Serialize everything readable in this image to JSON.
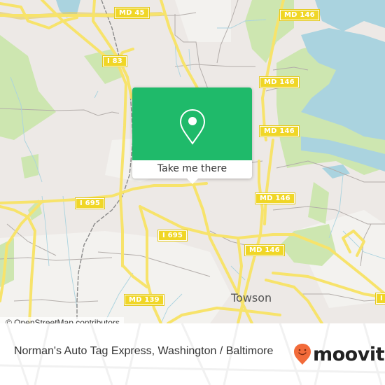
{
  "map": {
    "colors": {
      "land": "#ede9e6",
      "park": "#cde6b0",
      "water": "#aad3df",
      "road_major": "#f7e36b",
      "road_minor": "#b3adaa",
      "rail": "#8a8a8a",
      "shield": "#f0d626"
    },
    "road_labels": [
      {
        "id": "md45",
        "text": "MD 45"
      },
      {
        "id": "i83",
        "text": "I 83"
      },
      {
        "id": "md146-a",
        "text": "MD 146"
      },
      {
        "id": "md146-b",
        "text": "MD 146"
      },
      {
        "id": "md146-c",
        "text": "MD 146"
      },
      {
        "id": "md146-d",
        "text": "MD 146"
      },
      {
        "id": "md146-e",
        "text": "MD 146"
      },
      {
        "id": "i695-a",
        "text": "I 695"
      },
      {
        "id": "i695-b",
        "text": "I 695"
      },
      {
        "id": "md139",
        "text": "MD 139"
      },
      {
        "id": "partial-right",
        "text": "I"
      }
    ],
    "place_labels": [
      {
        "id": "towson",
        "text": "Towson"
      }
    ],
    "attribution": "© OpenStreetMap contributors"
  },
  "popup": {
    "icon": "map-pin-icon",
    "button_label": "Take me there",
    "accent": "#1fba6a"
  },
  "footer": {
    "title": "Norman's Auto Tag Express, Washington / Baltimore",
    "brand": "moovit",
    "brand_color": "#f26b3a"
  }
}
